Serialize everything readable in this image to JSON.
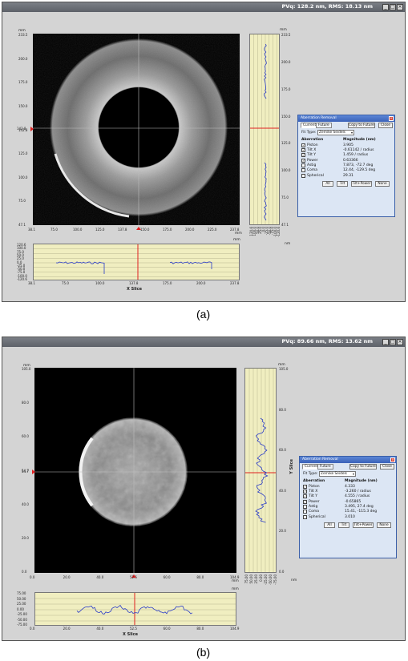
{
  "panels": [
    {
      "id": "a",
      "title": "PVq: 128.2 nm, RMS: 18.13 nm",
      "main_x_ticks": [
        "38.1",
        "75.0",
        "100.0",
        "125.0",
        "137.8",
        "150.0",
        "175.0",
        "200.0",
        "225.0",
        "237.8"
      ],
      "main_x_unit": "mm",
      "main_y_ticks": [
        "233.5",
        "200.0",
        "175.0",
        "150.0",
        "142.8",
        "125.0",
        "100.0",
        "75.0",
        "47.1"
      ],
      "main_y_unit": "mm",
      "cursor_y_label": "142.8",
      "xslice_y_ticks": [
        "120.6",
        "100.0",
        "75.0",
        "50.0",
        "25.0",
        "0.0",
        "-25.0",
        "-50.0",
        "-75.0",
        "-100.0",
        "-120.6"
      ],
      "xslice_x_ticks": [
        "38.1",
        "75.0",
        "100.0",
        "137.8",
        "175.0",
        "200.0",
        "237.8"
      ],
      "xslice_unit": "mm",
      "xslice_label": "X Slice",
      "yslice_y_ticks": [
        "233.5",
        "200.0",
        "175.0",
        "150.0",
        "125.0",
        "100.0",
        "75.0",
        "47.1"
      ],
      "yslice_x_ticks": [
        "120.6",
        "100.0",
        "50.0",
        "25.0",
        "0.0",
        "-25.0",
        "-50.0",
        "-75.0",
        "-100.0",
        "-120.6"
      ],
      "yslice_unit_top": "mm",
      "yslice_unit_bottom": "nm",
      "yslice_label": "",
      "dialog": {
        "title": "Aberration Removal",
        "tab_current": "Current",
        "tab_future": "Future",
        "copy_btn": "Copy to Future",
        "close_btn": "Close",
        "fit_type_label": "Fit Type:",
        "fit_type_value": "Zernike Seidels",
        "col_aberration": "Aberration",
        "col_magnitude": "Magnitude (nm)",
        "rows": [
          {
            "name": "Piston",
            "value": "3.905",
            "checked": true
          },
          {
            "name": "Tilt X",
            "value": "-0.61142 / radius",
            "checked": true
          },
          {
            "name": "Tilt Y",
            "value": "1.459 / radius",
            "checked": true
          },
          {
            "name": "Power",
            "value": "0.63366",
            "checked": true
          },
          {
            "name": "Astig",
            "value": "7.873, -72.7 deg",
            "checked": false
          },
          {
            "name": "Coma",
            "value": "12.44, -129.5 deg",
            "checked": false
          },
          {
            "name": "Spherical",
            "value": "29.31",
            "checked": false
          }
        ],
        "btn_all": "All",
        "btn_tilt": "Tilt",
        "btn_tilt_power": "Tilt+Power",
        "btn_none": "None"
      }
    },
    {
      "id": "b",
      "title": "PVq: 89.66 nm, RMS: 13.62 nm",
      "main_x_ticks": [
        "0.0",
        "20.0",
        "40.0",
        "52.5",
        "60.0",
        "80.0",
        "104.9"
      ],
      "main_x_unit": "mm",
      "main_y_ticks": [
        "105.0",
        "80.0",
        "60.0",
        "54.7",
        "40.0",
        "20.0",
        "0.0"
      ],
      "main_y_unit": "mm",
      "cursor_y_label": "54.7",
      "xslice_y_ticks": [
        "75.00",
        "50.00",
        "25.00",
        "0.00",
        "-25.00",
        "-50.00",
        "-75.00"
      ],
      "xslice_x_ticks": [
        "0.0",
        "20.0",
        "40.0",
        "52.5",
        "60.0",
        "80.0",
        "104.9"
      ],
      "xslice_unit": "mm",
      "xslice_label": "X Slice",
      "yslice_y_ticks": [
        "105.0",
        "80.0",
        "60.0",
        "40.0",
        "20.0",
        "0.0"
      ],
      "yslice_x_ticks": [
        "75.00",
        "50.00",
        "25.00",
        "0.00",
        "-25.00",
        "-50.00",
        "-75.00"
      ],
      "yslice_unit_top": "mm",
      "yslice_unit_bottom": "nm",
      "yslice_label": "Y Slice",
      "dialog": {
        "title": "Aberration Removal",
        "tab_current": "Current",
        "tab_future": "Future",
        "copy_btn": "Copy to Future",
        "close_btn": "Close",
        "fit_type_label": "Fit Type:",
        "fit_type_value": "Zernike Seidels",
        "col_aberration": "Aberration",
        "col_magnitude": "Magnitude (nm)",
        "rows": [
          {
            "name": "Piston",
            "value": "4.333",
            "checked": true
          },
          {
            "name": "Tilt X",
            "value": "-3.260 / radius",
            "checked": true
          },
          {
            "name": "Tilt Y",
            "value": "4.555 / radius",
            "checked": true
          },
          {
            "name": "Power",
            "value": "-0.65865",
            "checked": true
          },
          {
            "name": "Astig",
            "value": "3.495, 27.4 deg",
            "checked": false
          },
          {
            "name": "Coma",
            "value": "15.41, -115.3 deg",
            "checked": false
          },
          {
            "name": "Spherical",
            "value": "3.010",
            "checked": false
          }
        ],
        "btn_all": "All",
        "btn_tilt": "Tilt",
        "btn_tilt_power": "Tilt+Power",
        "btn_none": "None"
      }
    }
  ],
  "captions": [
    "(a)",
    "(b)"
  ],
  "colors": {
    "cursor": "#e02020",
    "profile": "#2a3cc8",
    "slice_bg": "#f0eec0",
    "dialog_title": "#3b62b8"
  }
}
